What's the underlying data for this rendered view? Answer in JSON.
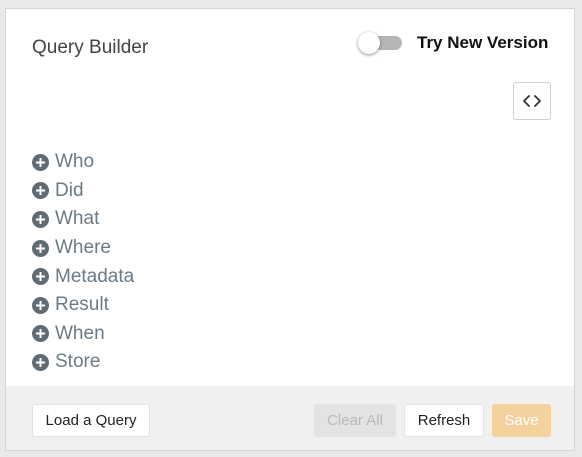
{
  "header": {
    "title": "Query Builder",
    "toggle": {
      "label": "Try New Version",
      "on": false
    }
  },
  "toolbar": {
    "code_icon": "code-brackets-icon"
  },
  "terms": [
    {
      "label": "Who",
      "icon": "plus-circle-icon"
    },
    {
      "label": "Did",
      "icon": "plus-circle-icon"
    },
    {
      "label": "What",
      "icon": "plus-circle-icon"
    },
    {
      "label": "Where",
      "icon": "plus-circle-icon"
    },
    {
      "label": "Metadata",
      "icon": "plus-circle-icon"
    },
    {
      "label": "Result",
      "icon": "plus-circle-icon"
    },
    {
      "label": "When",
      "icon": "plus-circle-icon"
    },
    {
      "label": "Store",
      "icon": "plus-circle-icon"
    }
  ],
  "footer": {
    "load_label": "Load a Query",
    "clear_label": "Clear All",
    "refresh_label": "Refresh",
    "save_label": "Save"
  },
  "colors": {
    "term_text": "#6b7a85",
    "icon_fill": "#5f6b75",
    "save_button": "#f5d19e",
    "toggle_track": "#b5b5b5"
  }
}
